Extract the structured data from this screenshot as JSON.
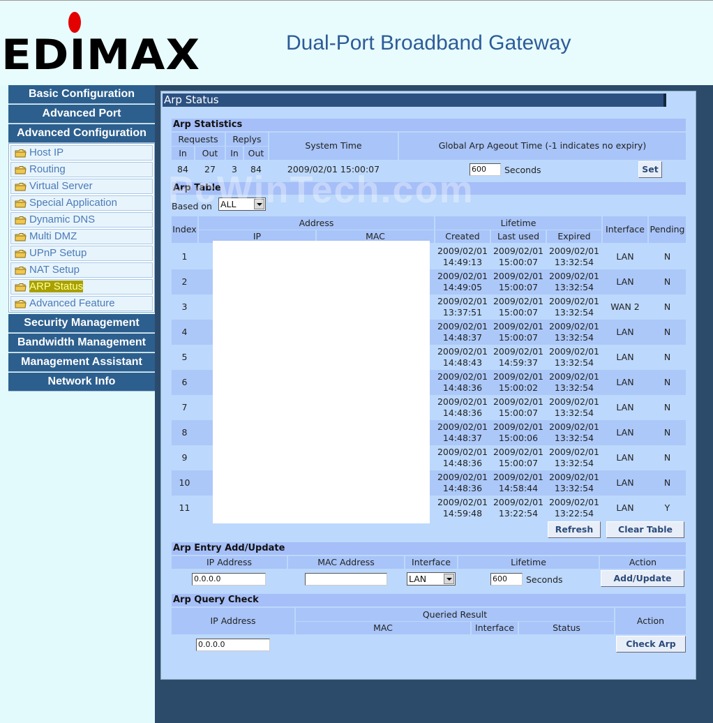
{
  "header": {
    "logo_text": "EDIMAX",
    "product_title": "Dual-Port Broadband Gateway"
  },
  "sidebar": {
    "main_top": [
      "Basic Configuration",
      "Advanced Port",
      "Advanced Configuration"
    ],
    "sub_items": [
      "Host IP",
      "Routing",
      "Virtual Server",
      "Special Application",
      "Dynamic DNS",
      "Multi DMZ",
      "UPnP Setup",
      "NAT Setup",
      "ARP Status",
      "Advanced Feature"
    ],
    "active_item": "ARP Status",
    "main_bottom": [
      "Security Management",
      "Bandwidth Management",
      "Management Assistant",
      "Network Info"
    ]
  },
  "page": {
    "title": "Arp Status",
    "watermark": "PcWinTech.com"
  },
  "stats": {
    "section": "Arp Statistics",
    "requests": "Requests",
    "replys": "Replys",
    "in": "In",
    "out": "Out",
    "system_time_label": "System Time",
    "ageout_label": "Global Arp Ageout Time (-1 indicates no expiry)",
    "req_in": "84",
    "req_out": "27",
    "rep_in": "3",
    "rep_out": "84",
    "system_time": "2009/02/01 15:00:07",
    "ageout_value": "600",
    "seconds": "Seconds",
    "set_button": "Set"
  },
  "arp_table": {
    "section": "Arp Table",
    "based_on_label": "Based on",
    "based_on_value": "ALL",
    "headers": {
      "index": "Index",
      "address": "Address",
      "ip": "IP",
      "mac": "MAC",
      "lifetime": "Lifetime",
      "created": "Created",
      "last_used": "Last used",
      "expired": "Expired",
      "interface": "Interface",
      "pending": "Pending"
    },
    "rows": [
      {
        "index": "1",
        "created_d": "2009/02/01",
        "created_t": "14:49:13",
        "last_d": "2009/02/01",
        "last_t": "15:00:07",
        "exp_d": "2009/02/01",
        "exp_t": "13:32:54",
        "iface": "LAN",
        "pending": "N"
      },
      {
        "index": "2",
        "created_d": "2009/02/01",
        "created_t": "14:49:05",
        "last_d": "2009/02/01",
        "last_t": "15:00:07",
        "exp_d": "2009/02/01",
        "exp_t": "13:32:54",
        "iface": "LAN",
        "pending": "N"
      },
      {
        "index": "3",
        "created_d": "2009/02/01",
        "created_t": "13:37:51",
        "last_d": "2009/02/01",
        "last_t": "15:00:07",
        "exp_d": "2009/02/01",
        "exp_t": "13:32:54",
        "iface": "WAN 2",
        "pending": "N"
      },
      {
        "index": "4",
        "created_d": "2009/02/01",
        "created_t": "14:48:37",
        "last_d": "2009/02/01",
        "last_t": "15:00:07",
        "exp_d": "2009/02/01",
        "exp_t": "13:32:54",
        "iface": "LAN",
        "pending": "N"
      },
      {
        "index": "5",
        "created_d": "2009/02/01",
        "created_t": "14:48:43",
        "last_d": "2009/02/01",
        "last_t": "14:59:37",
        "exp_d": "2009/02/01",
        "exp_t": "13:32:54",
        "iface": "LAN",
        "pending": "N"
      },
      {
        "index": "6",
        "created_d": "2009/02/01",
        "created_t": "14:48:36",
        "last_d": "2009/02/01",
        "last_t": "15:00:02",
        "exp_d": "2009/02/01",
        "exp_t": "13:32:54",
        "iface": "LAN",
        "pending": "N"
      },
      {
        "index": "7",
        "created_d": "2009/02/01",
        "created_t": "14:48:36",
        "last_d": "2009/02/01",
        "last_t": "15:00:07",
        "exp_d": "2009/02/01",
        "exp_t": "13:32:54",
        "iface": "LAN",
        "pending": "N"
      },
      {
        "index": "8",
        "created_d": "2009/02/01",
        "created_t": "14:48:37",
        "last_d": "2009/02/01",
        "last_t": "15:00:06",
        "exp_d": "2009/02/01",
        "exp_t": "13:32:54",
        "iface": "LAN",
        "pending": "N"
      },
      {
        "index": "9",
        "created_d": "2009/02/01",
        "created_t": "14:48:36",
        "last_d": "2009/02/01",
        "last_t": "15:00:07",
        "exp_d": "2009/02/01",
        "exp_t": "13:32:54",
        "iface": "LAN",
        "pending": "N"
      },
      {
        "index": "10",
        "created_d": "2009/02/01",
        "created_t": "14:48:36",
        "last_d": "2009/02/01",
        "last_t": "14:58:44",
        "exp_d": "2009/02/01",
        "exp_t": "13:32:54",
        "iface": "LAN",
        "pending": "N"
      },
      {
        "index": "11",
        "created_d": "2009/02/01",
        "created_t": "14:59:48",
        "last_d": "2009/02/01",
        "last_t": "13:22:54",
        "exp_d": "2009/02/01",
        "exp_t": "13:22:54",
        "iface": "LAN",
        "pending": "Y"
      }
    ],
    "refresh_button": "Refresh",
    "clear_button": "Clear Table"
  },
  "entry": {
    "section": "Arp Entry Add/Update",
    "ip_label": "IP Address",
    "mac_label": "MAC Address",
    "iface_label": "Interface",
    "lifetime_label": "Lifetime",
    "action_label": "Action",
    "ip_value": "0.0.0.0",
    "mac_value": "",
    "iface_value": "LAN",
    "lifetime_value": "600",
    "seconds": "Seconds",
    "add_button": "Add/Update"
  },
  "query": {
    "section": "Arp Query Check",
    "ip_label": "IP Address",
    "queried_label": "Queried Result",
    "mac_label": "MAC",
    "iface_label": "Interface",
    "status_label": "Status",
    "action_label": "Action",
    "ip_value": "0.0.0.0",
    "check_button": "Check Arp"
  }
}
